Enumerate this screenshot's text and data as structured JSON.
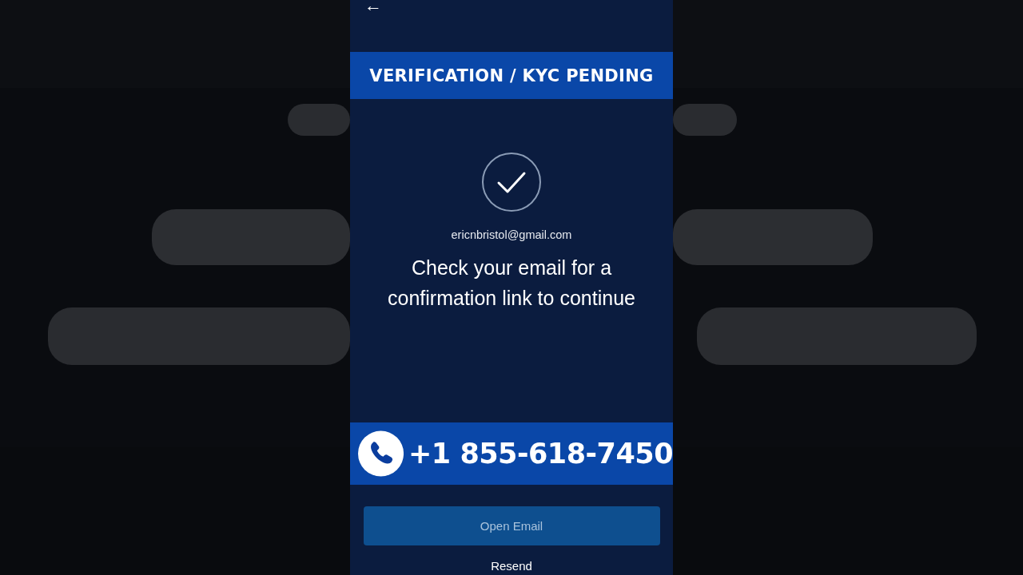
{
  "header": {
    "back": "←"
  },
  "banner": {
    "title": "VERIFICATION / KYC PENDING"
  },
  "confirmation": {
    "email": "ericnbristol@gmail.com",
    "message": "Check your email for a confirmation link to continue"
  },
  "phone_banner": {
    "number": "+1 855-618-7450"
  },
  "actions": {
    "primary": "Open Email",
    "secondary": "Resend"
  }
}
